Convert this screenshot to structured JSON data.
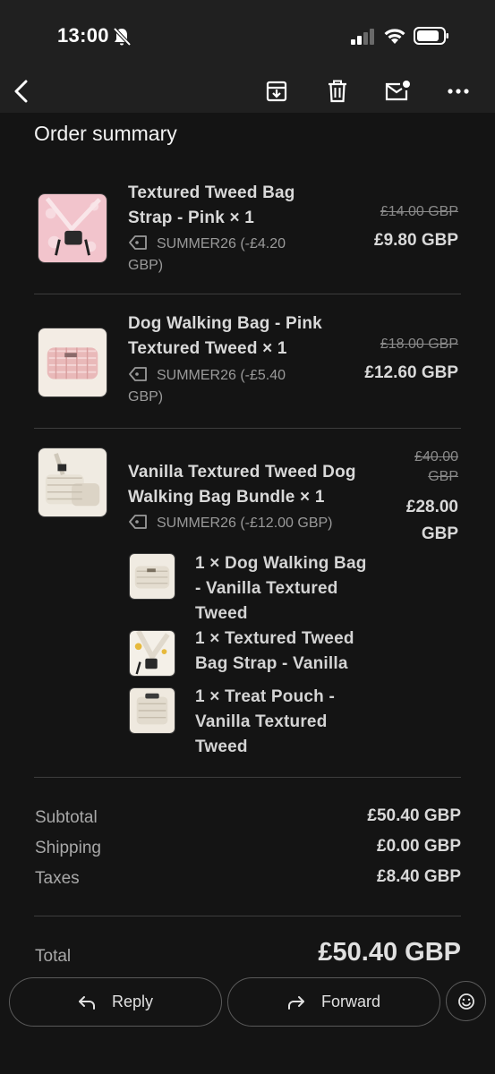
{
  "status": {
    "time": "13:00"
  },
  "toolbar": {
    "back_icon": "back-arrow-icon",
    "archive_icon": "archive-icon",
    "delete_icon": "trash-icon",
    "unread_icon": "mark-unread-icon",
    "more_icon": "more-horizontal-icon"
  },
  "order": {
    "title": "Order summary",
    "items": [
      {
        "name_line1": "Textured Tweed Bag",
        "name_line2": "Strap - Pink × 1",
        "discount_line1": "SUMMER26  (-£4.20",
        "discount_line2": "GBP)",
        "price_old": "£14.00 GBP",
        "price_new": "£9.80 GBP"
      },
      {
        "name_line1": "Dog Walking Bag - Pink",
        "name_line2": "Textured Tweed × 1",
        "discount_line1": "SUMMER26  (-£5.40",
        "discount_line2": "GBP)",
        "price_old": "£18.00 GBP",
        "price_new": "£12.60 GBP"
      },
      {
        "name_line1": "Vanilla Textured Tweed Dog",
        "name_line2": "Walking Bag Bundle × 1",
        "discount_line1": "SUMMER26  (-£12.00 GBP)",
        "price_old_line1": "£40.00",
        "price_old_line2": "GBP",
        "price_new_line1": "£28.00",
        "price_new_line2": "GBP",
        "components": [
          {
            "line1": "1 × Dog Walking Bag",
            "line2": "- Vanilla Textured",
            "line3": "Tweed"
          },
          {
            "line1": "1 × Textured Tweed",
            "line2": "Bag Strap - Vanilla"
          },
          {
            "line1": "1 × Treat Pouch -",
            "line2": "Vanilla Textured",
            "line3": "Tweed"
          }
        ]
      }
    ],
    "summary": {
      "subtotal_label": "Subtotal",
      "subtotal_value": "£50.40 GBP",
      "shipping_label": "Shipping",
      "shipping_value": "£0.00 GBP",
      "taxes_label": "Taxes",
      "taxes_value": "£8.40 GBP",
      "total_label": "Total",
      "total_value": "£50.40 GBP"
    }
  },
  "actions": {
    "reply_label": "Reply",
    "forward_label": "Forward",
    "emoji_icon": "emoji-smile-icon"
  },
  "colors": {
    "background": "#141414",
    "bar": "#202020",
    "text": "#d9d9d9",
    "muted": "#9a9a9a"
  }
}
